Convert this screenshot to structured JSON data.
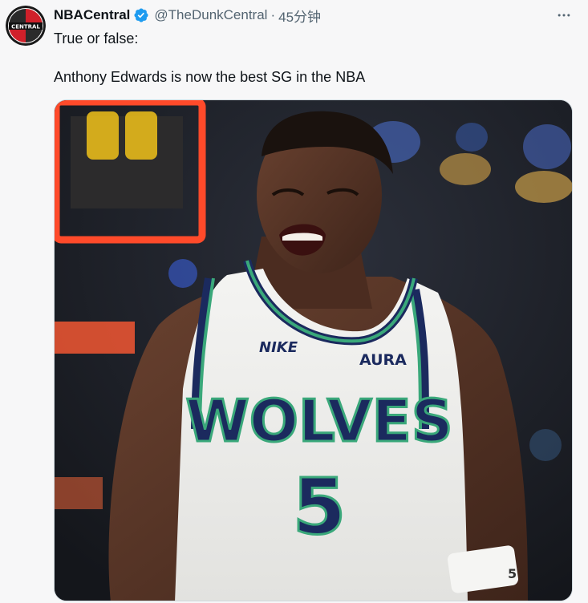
{
  "tweet": {
    "display_name": "NBACentral",
    "handle": "@TheDunkCentral",
    "separator": "·",
    "time": "45分钟",
    "text_line1": "True or false:",
    "text_line2": "Anthony Edwards is now the best SG in the NBA",
    "avatar_label": "CENTRAL"
  },
  "media": {
    "jersey_brand": "NIKE",
    "jersey_sponsor": "AURA",
    "jersey_team": "WOLVES",
    "jersey_number": "5",
    "wristband_text": "5"
  },
  "icons": {
    "verified": "verified-badge-icon",
    "more": "more-options-icon"
  },
  "colors": {
    "verified_blue": "#1d9bf0",
    "jersey_navy": "#1b2a5e",
    "jersey_green": "#3aa87a"
  }
}
